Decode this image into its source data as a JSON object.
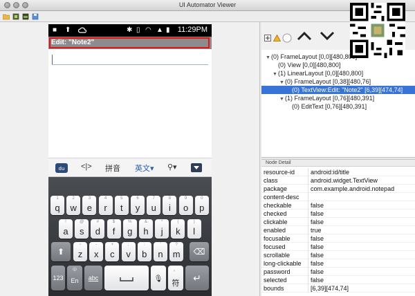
{
  "window": {
    "title": "UI Automator Viewer"
  },
  "toolbar": {
    "icons": [
      "open-folder-icon",
      "device-screenshot-icon",
      "compressed-screenshot-icon",
      "save-icon"
    ]
  },
  "device": {
    "status": {
      "time": "11:29PM"
    },
    "action_bar": {
      "title": "Edit: \"Note2\""
    },
    "ime": {
      "pinyin": "拼音",
      "english": "英文▾"
    },
    "keyboard": {
      "row1": [
        {
          "hint": "1",
          "key": "q"
        },
        {
          "hint": "2",
          "key": "w"
        },
        {
          "hint": "3",
          "key": "e"
        },
        {
          "hint": "4",
          "key": "r"
        },
        {
          "hint": "5",
          "key": "t"
        },
        {
          "hint": "6",
          "key": "y"
        },
        {
          "hint": "7",
          "key": "u"
        },
        {
          "hint": "8",
          "key": "i"
        },
        {
          "hint": "9",
          "key": "o"
        },
        {
          "hint": "0",
          "key": "p"
        }
      ],
      "row2": [
        {
          "hint": "!",
          "key": "a"
        },
        {
          "hint": "@",
          "key": "s"
        },
        {
          "hint": "#",
          "key": "d"
        },
        {
          "hint": "$",
          "key": "f"
        },
        {
          "hint": "%",
          "key": "g"
        },
        {
          "hint": "&",
          "key": "h"
        },
        {
          "hint": "*",
          "key": "j"
        },
        {
          "hint": "(",
          "key": "k"
        },
        {
          "hint": ")",
          "key": "l"
        }
      ],
      "row3": [
        {
          "hint": "~",
          "key": "z"
        },
        {
          "hint": "-",
          "key": "x"
        },
        {
          "hint": "+",
          "key": "c"
        },
        {
          "hint": ";",
          "key": "v"
        },
        {
          "hint": ":",
          "key": "b"
        },
        {
          "hint": "'",
          "key": "n"
        },
        {
          "hint": "?",
          "key": "m"
        }
      ],
      "bottom": {
        "numbers": "123",
        "lang_hint": "中",
        "lang": "En",
        "abc": "abc",
        "punct_hint": "。",
        "punct": "符"
      }
    }
  },
  "hierarchy": {
    "rows": [
      {
        "indent": 0,
        "arrow": "▼",
        "text": "(0) FrameLayout [0,0][480,800]"
      },
      {
        "indent": 1,
        "arrow": "",
        "text": "(0) View [0,0][480,800]"
      },
      {
        "indent": 1,
        "arrow": "▼",
        "text": "(1) LinearLayout [0,0][480,800]"
      },
      {
        "indent": 2,
        "arrow": "▼",
        "text": "(0) FrameLayout [0,38][480,76]"
      },
      {
        "indent": 3,
        "arrow": "",
        "text": "(0) TextView:Edit: \"Note2\" [6,39][474,74]",
        "selected": true
      },
      {
        "indent": 2,
        "arrow": "▼",
        "text": "(1) FrameLayout [0,76][480,391]"
      },
      {
        "indent": 3,
        "arrow": "",
        "text": "(0) EditText [0,76][480,391]"
      }
    ]
  },
  "detail": {
    "header": "Node Detail",
    "rows": [
      {
        "key": "resource-id",
        "value": "android:id/title"
      },
      {
        "key": "class",
        "value": "android.widget.TextView"
      },
      {
        "key": "package",
        "value": "com.example.android.notepad"
      },
      {
        "key": "content-desc",
        "value": ""
      },
      {
        "key": "checkable",
        "value": "false"
      },
      {
        "key": "checked",
        "value": "false"
      },
      {
        "key": "clickable",
        "value": "false"
      },
      {
        "key": "enabled",
        "value": "true"
      },
      {
        "key": "focusable",
        "value": "false"
      },
      {
        "key": "focused",
        "value": "false"
      },
      {
        "key": "scrollable",
        "value": "false"
      },
      {
        "key": "long-clickable",
        "value": "false"
      },
      {
        "key": "password",
        "value": "false"
      },
      {
        "key": "selected",
        "value": "false"
      },
      {
        "key": "bounds",
        "value": "[6,39][474,74]"
      }
    ]
  }
}
